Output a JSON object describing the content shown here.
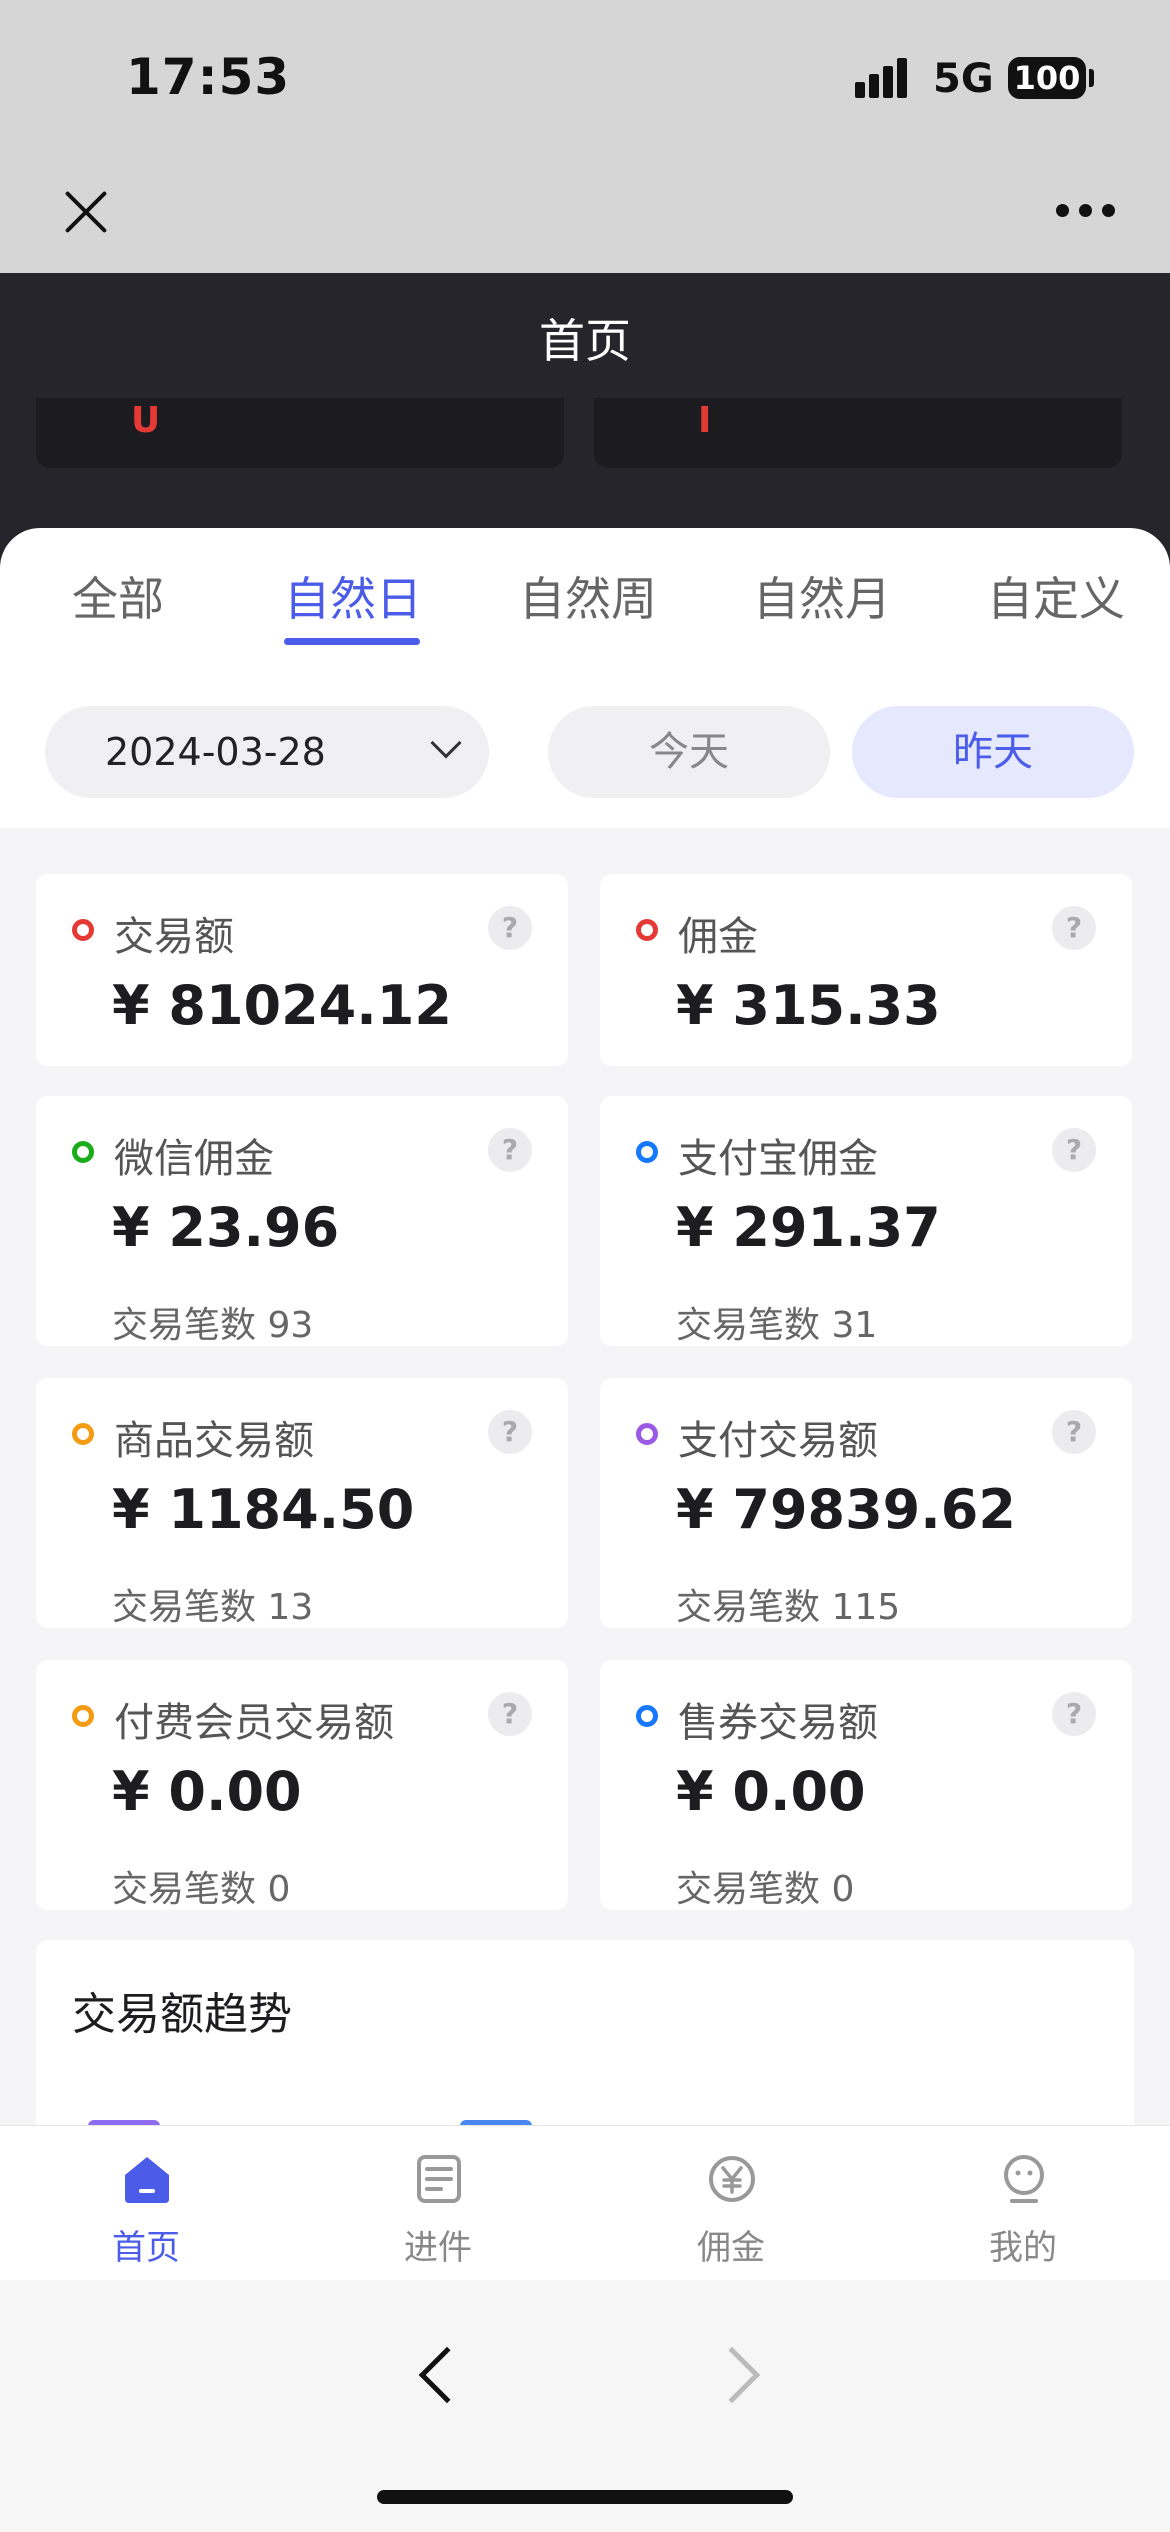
{
  "status": {
    "time": "17:53",
    "network": "5G",
    "battery": "100"
  },
  "header": {
    "title": "首页",
    "card_marks": [
      "U",
      "I"
    ]
  },
  "tabs": [
    {
      "label": "全部"
    },
    {
      "label": "自然日"
    },
    {
      "label": "自然周"
    },
    {
      "label": "自然月"
    },
    {
      "label": "自定义"
    }
  ],
  "date_filter": {
    "date": "2024-03-28",
    "today": "今天",
    "yesterday": "昨天"
  },
  "cards": [
    {
      "label": "交易额",
      "value": "¥ 81024.12",
      "sub": ""
    },
    {
      "label": "佣金",
      "value": "¥ 315.33",
      "sub": ""
    },
    {
      "label": "微信佣金",
      "value": "¥ 23.96",
      "sub": "交易笔数 93"
    },
    {
      "label": "支付宝佣金",
      "value": "¥ 291.37",
      "sub": "交易笔数 31"
    },
    {
      "label": "商品交易额",
      "value": "¥ 1184.50",
      "sub": "交易笔数 13"
    },
    {
      "label": "支付交易额",
      "value": "¥ 79839.62",
      "sub": "交易笔数 115"
    },
    {
      "label": "付费会员交易额",
      "value": "¥ 0.00",
      "sub": "交易笔数 0"
    },
    {
      "label": "售券交易额",
      "value": "¥ 0.00",
      "sub": "交易笔数 0"
    }
  ],
  "help_glyph": "?",
  "dot_colors": [
    "#e53935",
    "#e53935",
    "#1aad19",
    "#1677ff",
    "#f39c12",
    "#9b59e6",
    "#f39c12",
    "#1677ff"
  ],
  "trend": {
    "title": "交易额趋势",
    "legend_colors": [
      "#8e6cf0",
      "#4a86f0"
    ]
  },
  "tabbar": [
    {
      "label": "首页",
      "icon": "home-icon"
    },
    {
      "label": "进件",
      "icon": "document-icon"
    },
    {
      "label": "佣金",
      "icon": "yen-coin-icon"
    },
    {
      "label": "我的",
      "icon": "profile-face-icon"
    }
  ]
}
